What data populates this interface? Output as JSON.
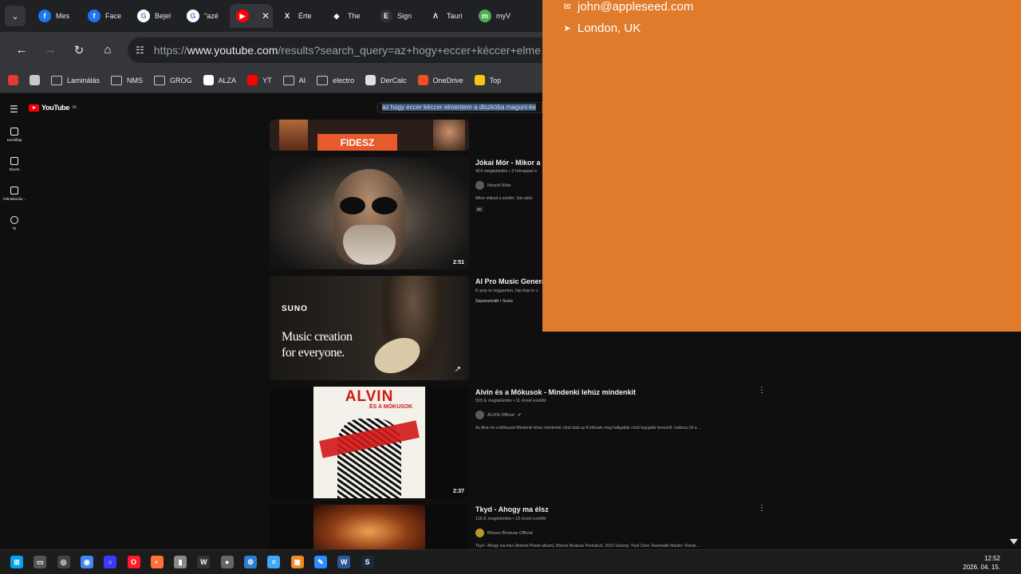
{
  "browser": {
    "tabs": [
      {
        "label": "Mes",
        "icon": "facebook-icon",
        "color": "#1877f2",
        "glyph": "f"
      },
      {
        "label": "Face",
        "icon": "facebook-icon",
        "color": "#1877f2",
        "glyph": "f"
      },
      {
        "label": "Bejel",
        "icon": "google-icon",
        "color": "#ffffff",
        "glyph": "G"
      },
      {
        "label": "\"azé",
        "icon": "google-icon",
        "color": "#ffffff",
        "glyph": "G"
      },
      {
        "label": "",
        "icon": "youtube-icon",
        "color": "#ff0000",
        "glyph": "▶",
        "active": true
      },
      {
        "label": "Érte",
        "icon": "x-icon",
        "color": "#202124",
        "glyph": "X"
      },
      {
        "label": "The",
        "icon": "app-icon",
        "color": "#202124",
        "glyph": "◆"
      },
      {
        "label": "Sign",
        "icon": "epic-icon",
        "color": "#333333",
        "glyph": "E"
      },
      {
        "label": "Tauri",
        "icon": "lambda-icon",
        "color": "#202124",
        "glyph": "Λ"
      },
      {
        "label": "myV",
        "icon": "mv-icon",
        "color": "#4caf50",
        "glyph": "m"
      }
    ],
    "url_prefix": "https://",
    "url_host": "www.youtube.com",
    "url_rest": "/results?search_query=az+hogy+eccer+kéccer+elme",
    "bookmarks": [
      {
        "label": "",
        "kind": "app-icon",
        "color": "#e53935"
      },
      {
        "label": "",
        "kind": "grid-icon",
        "color": "#c8c8c8"
      },
      {
        "label": "Laminálás",
        "kind": "folder-icon"
      },
      {
        "label": "NMS",
        "kind": "folder-icon"
      },
      {
        "label": "GROG",
        "kind": "folder-icon"
      },
      {
        "label": "ALZA",
        "kind": "alza-icon",
        "color": "#ffffff"
      },
      {
        "label": "YT",
        "kind": "youtube-icon",
        "color": "#ff0000"
      },
      {
        "label": "AI",
        "kind": "folder-icon"
      },
      {
        "label": "electro",
        "kind": "folder-icon"
      },
      {
        "label": "DerCalc",
        "kind": "dercalc-icon",
        "color": "#e0e0e0"
      },
      {
        "label": "OneDrive",
        "kind": "windows-icon",
        "color": "#f25022"
      },
      {
        "label": "Top",
        "kind": "imdb-icon",
        "color": "#f5c518"
      }
    ]
  },
  "youtube": {
    "logo_text": "YouTube",
    "logo_sup": "SK",
    "search_query": "az hogy eccer kéccer elmentem a diszkóba maguni-ke",
    "sidebar": [
      {
        "label": "Kezdőlap",
        "icon": "home-icon"
      },
      {
        "label": "Shorts",
        "icon": "shorts-icon"
      },
      {
        "label": "Feliratkozás...",
        "icon": "subscriptions-icon"
      },
      {
        "label": "Te",
        "icon": "account-icon"
      }
    ],
    "partial_thumb_text": "FIDESZ",
    "videos": [
      {
        "title": "Jókai Mór - Mikor a s",
        "meta": "424 megtekintés • 3 hónappal e",
        "channel": "Neurál Nóta",
        "desc": "Mikor elakad a szekér. Van akko",
        "badge": "4K",
        "duration": "2:51"
      },
      {
        "title": "AI Pro Music Generat",
        "meta": "K-pop to reggaeton, hip-hop to c",
        "channel": "Szponzorált • Suno",
        "thumb_brand": "SUNO",
        "thumb_line1": "Music creation",
        "thumb_line2": "for everyone."
      },
      {
        "title": "Alvin és a Mókusok - Mindenki lehúz mindenkit",
        "meta": "315 E megtekintés • 11 évvel ezelőtt",
        "channel": "ALVIN Official",
        "desc": "Az Alvin és a Mókusok Mindenki lehúz mindenkit című dala az A bölcsek meg hallgattak című legújabb lemezről. Iratkozz fel a ...",
        "duration": "2:37",
        "thumb_title": "ALVIN",
        "thumb_sub": "ÉS A MÓKUSOK"
      },
      {
        "title": "Tkyd - Ahogy ma élsz",
        "meta": "116 E megtekintés • 10 évvel ezelőtt",
        "channel": "Blooso Broavaz Official",
        "desc": "Tkyd - Ahogy ma élsz (Animal Planet album), Blooso Broavaz Produkció, 2015 Szöveg: Tkyd Zene: Rawmatik Master: Remix ..."
      }
    ]
  },
  "contact_card": {
    "email": "john@appleseed.com",
    "location": "London, UK",
    "bg_color": "#e07b2c"
  },
  "taskbar": {
    "time": "12:52",
    "date": "2026. 04. 15.",
    "apps": [
      {
        "name": "windows-start-icon",
        "color": "#00a4ef",
        "glyph": "⊞"
      },
      {
        "name": "file-explorer-icon",
        "color": "#555555",
        "glyph": "▭"
      },
      {
        "name": "chrome-dev-icon",
        "color": "#444444",
        "glyph": "◎"
      },
      {
        "name": "chrome-icon",
        "color": "#4285f4",
        "glyph": "◉"
      },
      {
        "name": "app-circle-icon",
        "color": "#3a3aff",
        "glyph": "○"
      },
      {
        "name": "opera-icon",
        "color": "#ff1b2d",
        "glyph": "O"
      },
      {
        "name": "firefox-icon",
        "color": "#ff7139",
        "glyph": "◐"
      },
      {
        "name": "device-icon",
        "color": "#888888",
        "glyph": "▮"
      },
      {
        "name": "winamp-icon",
        "color": "#333333",
        "glyph": "W"
      },
      {
        "name": "app-dark-icon",
        "color": "#666666",
        "glyph": "●"
      },
      {
        "name": "settings-icon",
        "color": "#2a7fd4",
        "glyph": "⚙"
      },
      {
        "name": "notepad-icon",
        "color": "#3fa9f5",
        "glyph": "≡"
      },
      {
        "name": "photo-app-icon",
        "color": "#f08a24",
        "glyph": "▣"
      },
      {
        "name": "paint-icon",
        "color": "#2d8cff",
        "glyph": "✎"
      },
      {
        "name": "word-icon",
        "color": "#2b579a",
        "glyph": "W"
      },
      {
        "name": "steam-icon",
        "color": "#1b2838",
        "glyph": "S"
      }
    ]
  }
}
